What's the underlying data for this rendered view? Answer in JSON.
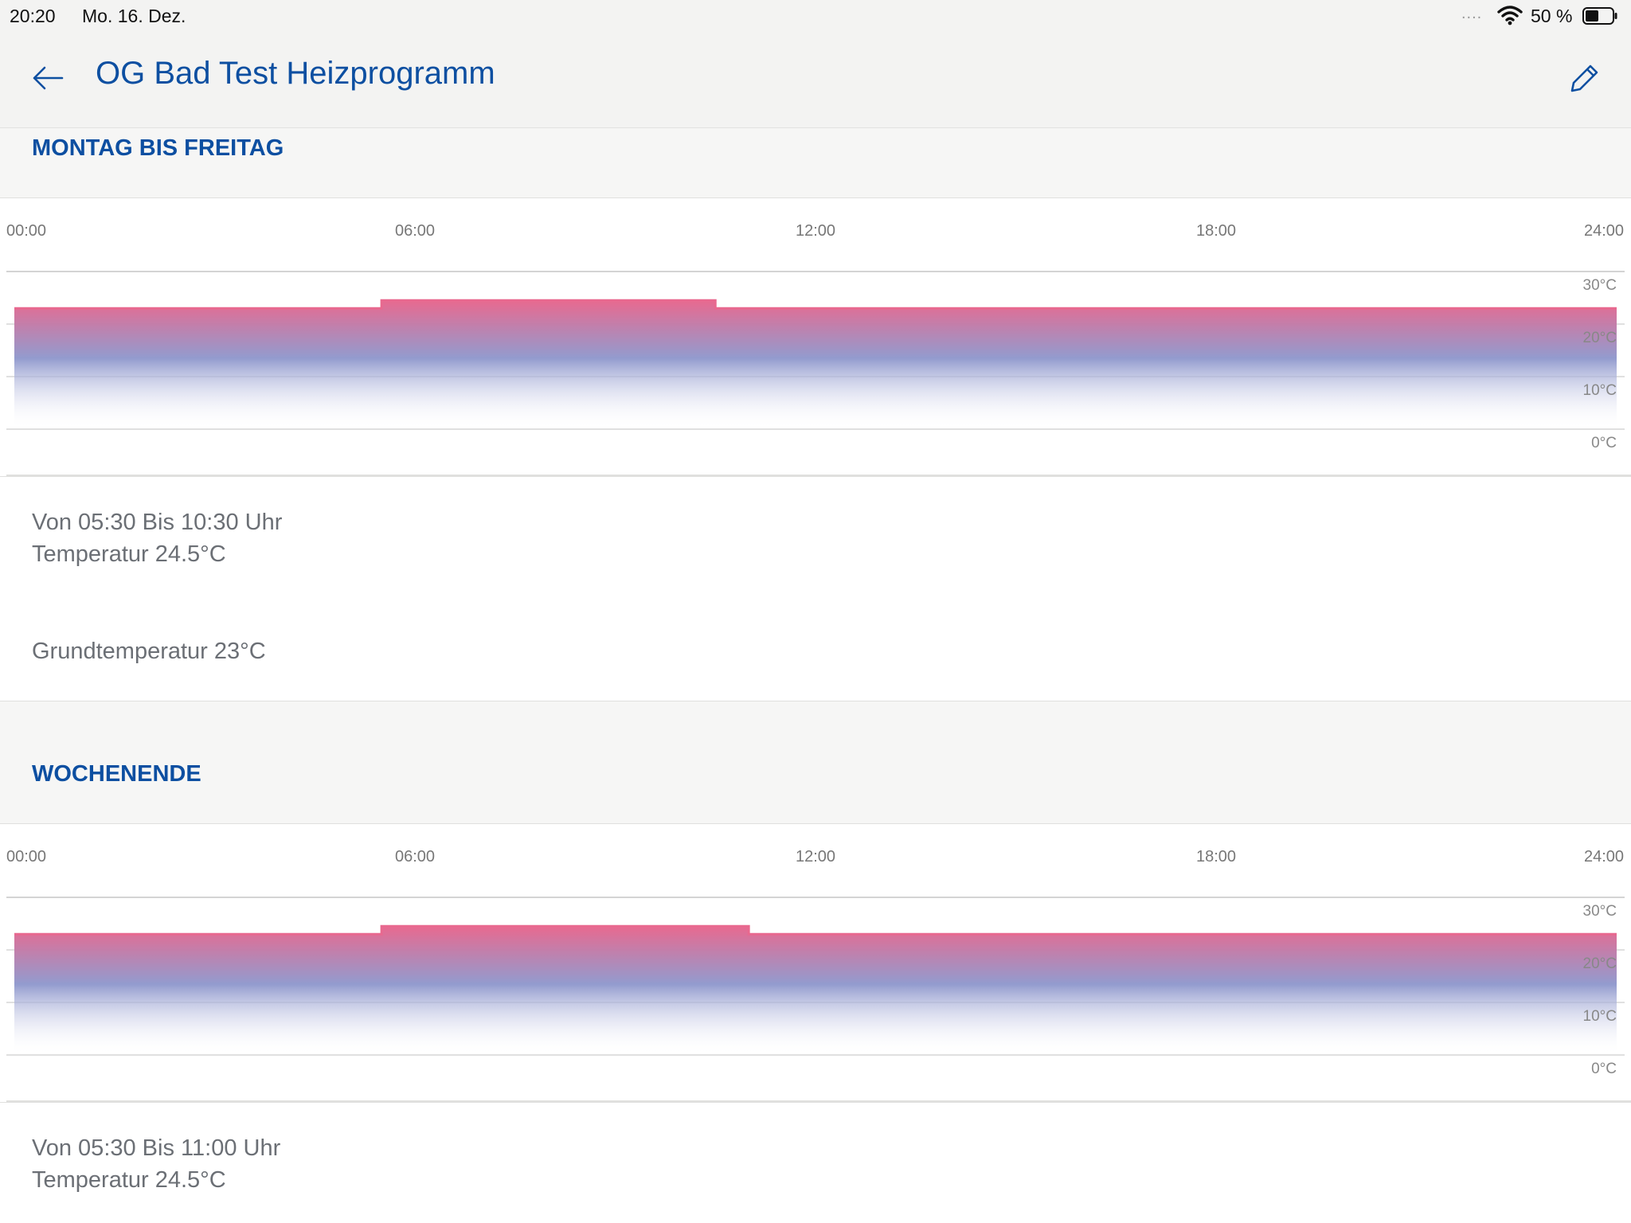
{
  "status_bar": {
    "time": "20:20",
    "date": "Mo. 16. Dez.",
    "signal": "....",
    "battery_text": "50 %",
    "battery_level": 0.5
  },
  "header": {
    "title": "OG Bad Test Heizprogramm",
    "back_icon": "arrow-left-icon",
    "edit_icon": "pencil-icon"
  },
  "colors": {
    "accent": "#0d4fa1",
    "curve_top": "#e8698f",
    "curve_mid": "#8d96cc",
    "text_muted": "#6b6f75"
  },
  "sections": [
    {
      "title": "MONTAG BIS FREITAG",
      "entries": [
        {
          "line1": "Von 05:30 Bis 10:30 Uhr",
          "line2": "Temperatur 24.5°C"
        },
        {
          "line1": "Grundtemperatur 23°C"
        }
      ]
    },
    {
      "title": "WOCHENENDE",
      "entries": [
        {
          "line1": "Von 05:30 Bis 11:00 Uhr",
          "line2": "Temperatur 24.5°C"
        }
      ]
    }
  ],
  "chart_data": [
    {
      "type": "area",
      "x_ticks": [
        "00:00",
        "06:00",
        "12:00",
        "18:00",
        "24:00"
      ],
      "y_ticks": [
        "30°C",
        "20°C",
        "10°C",
        "0°C"
      ],
      "xlim": [
        0,
        24
      ],
      "ylim": [
        0,
        30
      ],
      "grid": true,
      "series": [
        {
          "x": [
            0,
            5.5,
            5.5,
            10.5,
            10.5,
            24
          ],
          "y": [
            23,
            23,
            24.5,
            24.5,
            23,
            23
          ]
        }
      ]
    },
    {
      "type": "area",
      "x_ticks": [
        "00:00",
        "06:00",
        "12:00",
        "18:00",
        "24:00"
      ],
      "y_ticks": [
        "30°C",
        "20°C",
        "10°C",
        "0°C"
      ],
      "xlim": [
        0,
        24
      ],
      "ylim": [
        0,
        30
      ],
      "grid": true,
      "series": [
        {
          "x": [
            0,
            5.5,
            5.5,
            11,
            11,
            24
          ],
          "y": [
            23,
            23,
            24.5,
            24.5,
            23,
            23
          ]
        }
      ]
    }
  ]
}
